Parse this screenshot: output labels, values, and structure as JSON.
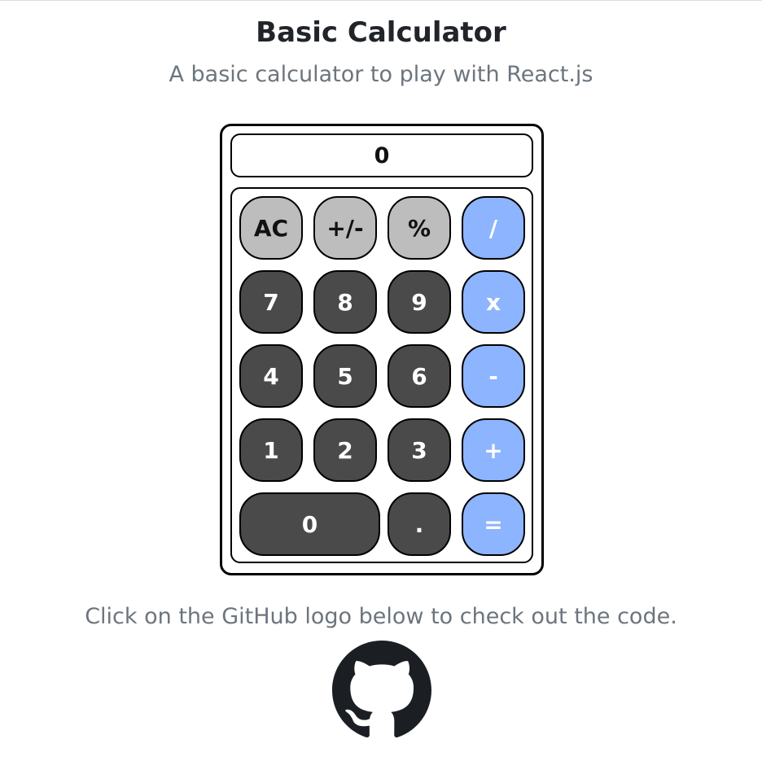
{
  "header": {
    "title": "Basic Calculator",
    "subtitle": "A basic calculator to play with React.js"
  },
  "calculator": {
    "display_value": "0",
    "keys": {
      "ac": "AC",
      "sign": "+/-",
      "percent": "%",
      "divide": "/",
      "seven": "7",
      "eight": "8",
      "nine": "9",
      "multiply": "x",
      "four": "4",
      "five": "5",
      "six": "6",
      "subtract": "-",
      "one": "1",
      "two": "2",
      "three": "3",
      "add": "+",
      "zero": "0",
      "decimal": ".",
      "equals": "="
    },
    "colors": {
      "function_key": "#bdbdbd",
      "number_key": "#4a4a4a",
      "operator_key": "#8db4fe"
    }
  },
  "footer": {
    "text": "Click on the GitHub logo below to check out the code.",
    "logo_icon": "github-icon"
  }
}
